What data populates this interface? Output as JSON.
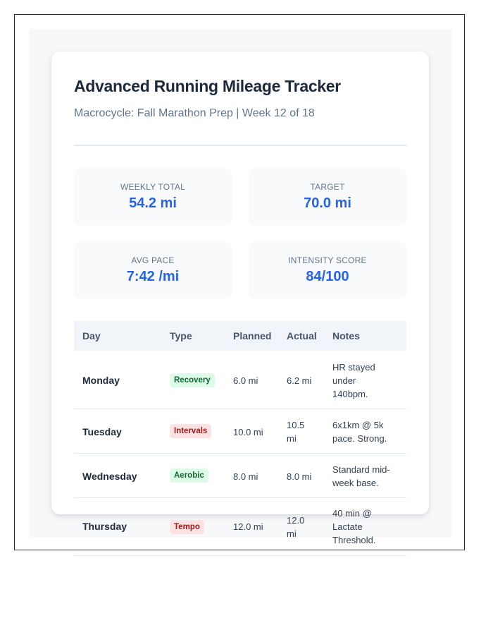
{
  "header": {
    "title": "Advanced Running Mileage Tracker",
    "subtitle": "Macrocycle: Fall Marathon Prep | Week 12 of 18"
  },
  "stats": [
    {
      "label": "Weekly Total",
      "value": "54.2 mi"
    },
    {
      "label": "Target",
      "value": "70.0 mi"
    },
    {
      "label": "Avg Pace",
      "value": "7:42 /mi"
    },
    {
      "label": "Intensity Score",
      "value": "84/100"
    }
  ],
  "table": {
    "columns": [
      "Day",
      "Type",
      "Planned",
      "Actual",
      "Notes"
    ],
    "rows": [
      {
        "day": "Monday",
        "type": "Recovery",
        "planned": "6.0 mi",
        "actual": "6.2 mi",
        "notes": "HR stayed under 140bpm."
      },
      {
        "day": "Tuesday",
        "type": "Intervals",
        "planned": "10.0 mi",
        "actual": "10.5 mi",
        "notes": "6x1km @ 5k pace. Strong."
      },
      {
        "day": "Wednesday",
        "type": "Aerobic",
        "planned": "8.0 mi",
        "actual": "8.0 mi",
        "notes": "Standard mid-week base."
      },
      {
        "day": "Thursday",
        "type": "Tempo",
        "planned": "12.0 mi",
        "actual": "12.0 mi",
        "notes": "40 min @ Lactate Threshold."
      }
    ]
  },
  "colors": {
    "accent": "#2563eb",
    "recovery_bg": "#dcfce7",
    "recovery_fg": "#166534",
    "intervals_bg": "#fee2e2",
    "intervals_fg": "#991b1b",
    "aerobic_bg": "#dcfce7",
    "aerobic_fg": "#166534",
    "tempo_bg": "#fee2e2",
    "tempo_fg": "#991b1b"
  }
}
